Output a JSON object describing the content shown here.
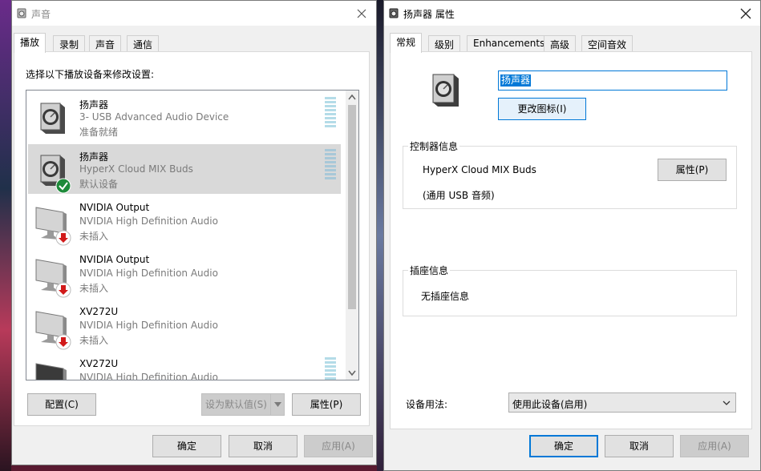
{
  "sound_window": {
    "title": "声音",
    "tabs": [
      "播放",
      "录制",
      "声音",
      "通信"
    ],
    "instruction": "选择以下播放设备来修改设置:",
    "devices": [
      {
        "name": "扬声器",
        "detail": "3- USB Advanced Audio Device",
        "status": "准备就绪",
        "icon": "speaker-icon"
      },
      {
        "name": "扬声器",
        "detail": "HyperX Cloud MIX Buds",
        "status": "默认设备",
        "icon": "speaker-icon",
        "badge": "default-check-icon"
      },
      {
        "name": "NVIDIA Output",
        "detail": "NVIDIA High Definition Audio",
        "status": "未插入",
        "icon": "monitor-icon",
        "badge": "unplugged-arrow-icon"
      },
      {
        "name": "NVIDIA Output",
        "detail": "NVIDIA High Definition Audio",
        "status": "未插入",
        "icon": "monitor-icon",
        "badge": "unplugged-arrow-icon"
      },
      {
        "name": "XV272U",
        "detail": "NVIDIA High Definition Audio",
        "status": "未插入",
        "icon": "monitor-icon",
        "badge": "unplugged-arrow-icon"
      },
      {
        "name": "XV272U",
        "detail": "NVIDIA High Definition Audio",
        "status": "",
        "icon": "monitor-icon"
      }
    ],
    "buttons": {
      "configure": "配置(C)",
      "set_default": "设为默认值(S)",
      "properties": "属性(P)",
      "ok": "确定",
      "cancel": "取消",
      "apply": "应用(A)"
    }
  },
  "props_window": {
    "title": "扬声器 属性",
    "tabs": [
      "常规",
      "级别",
      "Enhancements",
      "高级",
      "空间音效"
    ],
    "device_name_value": "扬声器",
    "change_icon_button": "更改图标(I)",
    "controller_group": {
      "title": "控制器信息",
      "device": "HyperX Cloud MIX Buds",
      "type": "(通用 USB 音频)",
      "properties_button": "属性(P)"
    },
    "jack_group": {
      "title": "插座信息",
      "text": "无插座信息"
    },
    "device_usage_label": "设备用法:",
    "device_usage_value": "使用此设备(启用)",
    "buttons": {
      "ok": "确定",
      "cancel": "取消",
      "apply": "应用(A)"
    }
  },
  "colors": {
    "accent": "#0078d7",
    "selected_row": "#d9d9d9",
    "default_check": "#1e8a3a",
    "unplugged": "#d11a1a",
    "meter": "#b4dce8"
  }
}
